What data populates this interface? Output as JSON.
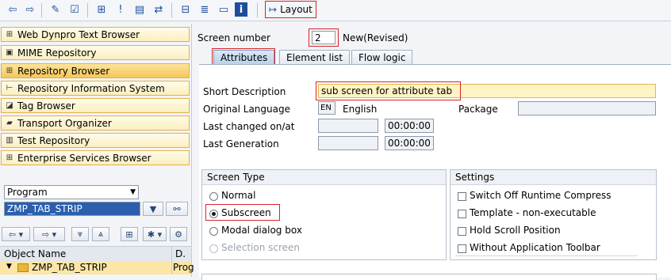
{
  "toolbar": {
    "icons": [
      "back-arrow-icon",
      "forward-arrow-icon",
      "edit-pencil-icon",
      "check-icon",
      "hierarchy-icon",
      "where-used-icon",
      "display-object-icon",
      "navigate-icon",
      "object-list-icon",
      "stack-icon",
      "screen-icon",
      "info-icon"
    ],
    "layout_label": "Layout"
  },
  "nav": {
    "items": [
      {
        "label": "Web Dynpro Text Browser",
        "icon": "hierarchy-icon"
      },
      {
        "label": "MIME Repository",
        "icon": "mime-icon"
      },
      {
        "label": "Repository Browser",
        "icon": "hierarchy-icon",
        "active": true
      },
      {
        "label": "Repository Information System",
        "icon": "tree-icon"
      },
      {
        "label": "Tag Browser",
        "icon": "tag-icon"
      },
      {
        "label": "Transport Organizer",
        "icon": "truck-icon"
      },
      {
        "label": "Test Repository",
        "icon": "test-icon"
      },
      {
        "label": "Enterprise Services Browser",
        "icon": "hierarchy-icon"
      }
    ],
    "object_type": "Program",
    "object_name": "ZMP_TAB_STRIP",
    "columns": {
      "name": "Object Name",
      "desc": "D."
    },
    "row": {
      "name": "ZMP_TAB_STRIP",
      "desc": "Prog"
    }
  },
  "screen": {
    "number_label": "Screen number",
    "number": "2",
    "status": "New(Revised)",
    "tabs": [
      "Attributes",
      "Element list",
      "Flow logic"
    ],
    "short_desc_label": "Short Description",
    "short_desc": "sub screen for attribute tab",
    "orig_lang_label": "Original Language",
    "orig_lang_code": "EN",
    "orig_lang_name": "English",
    "package_label": "Package",
    "package": "",
    "last_changed_label": "Last changed on/at",
    "last_changed_time": "00:00:00",
    "last_gen_label": "Last Generation",
    "last_gen_time": "00:00:00"
  },
  "screen_type": {
    "title": "Screen Type",
    "options": [
      "Normal",
      "Subscreen",
      "Modal dialog box",
      "Selection screen"
    ],
    "selected": "Subscreen"
  },
  "settings": {
    "title": "Settings",
    "options": [
      "Switch Off Runtime Compress",
      "Template - non-executable",
      "Hold Scroll Position",
      "Without Application Toolbar"
    ]
  },
  "colors": {
    "highlight": "#d8232a",
    "nav_bg": "#fbeec0",
    "active_field": "#fef4c4"
  }
}
